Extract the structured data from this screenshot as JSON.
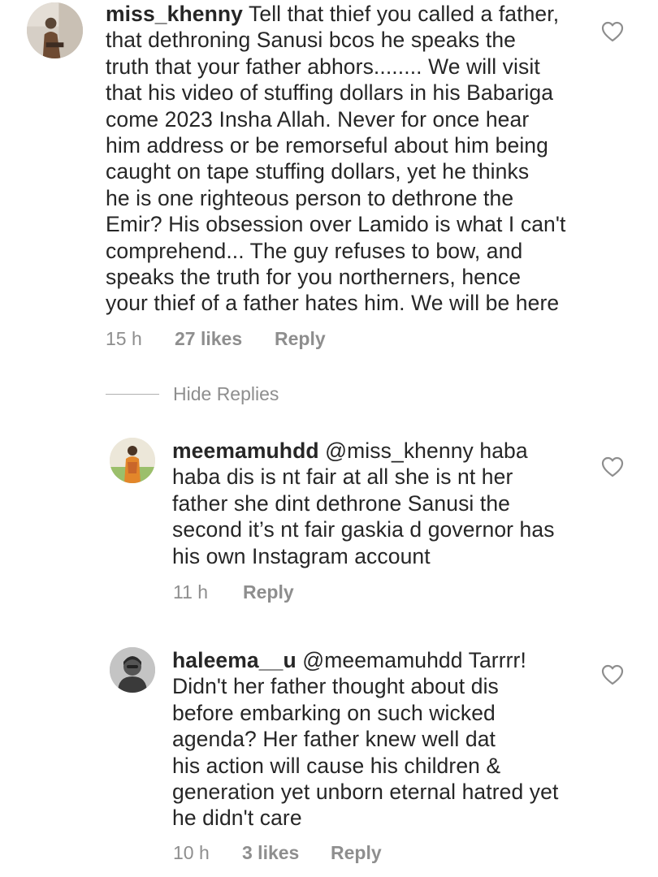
{
  "comments": [
    {
      "username": "miss_khenny",
      "mention": "",
      "lines": [
        "Tell that thief you called a father,",
        "that dethroning Sanusi bcos he speaks the",
        "truth that your father abhors........ We will visit",
        "that his video of stuffing dollars in his Babariga",
        "come 2023 Insha Allah. Never for once hear",
        "him address or be remorseful about him being",
        "caught on tape stuffing dollars,  yet he thinks",
        "he is one righteous person to dethrone the",
        "Emir? His obsession over Lamido is what I can't",
        "comprehend... The guy refuses to bow, and",
        "speaks the truth for you northerners,  hence",
        "your thief of a father hates him.  We will be here"
      ],
      "time": "15 h",
      "likes": "27 likes",
      "reply": "Reply",
      "avatar_icon": "user-avatar-photo",
      "heart_icon": "heart-outline-icon"
    },
    {
      "username": "meemamuhdd",
      "mention": "@miss_khenny",
      "lines": [
        "haba",
        "haba dis is nt fair at all she is nt her",
        "father she dint dethrone Sanusi the",
        "second it’s nt fair gaskia d governor has",
        "his own Instagram account"
      ],
      "time": "11 h",
      "likes": "",
      "reply": "Reply",
      "avatar_icon": "user-avatar-photo",
      "heart_icon": "heart-outline-icon"
    },
    {
      "username": "haleema__u",
      "mention": "@meemamuhdd",
      "lines": [
        "Tarrrr!",
        "Didn't her father thought about dis",
        "before embarking on such wicked",
        "agenda? Her father knew well dat",
        "his action will cause his children &",
        "generation yet unborn eternal hatred yet",
        "he didn't care"
      ],
      "time": "10 h",
      "likes": "3 likes",
      "reply": "Reply",
      "avatar_icon": "user-avatar-photo",
      "heart_icon": "heart-outline-icon"
    }
  ],
  "hide_replies_label": "Hide Replies",
  "colors": {
    "text": "#262626",
    "meta": "#8e8e8e",
    "background": "#ffffff"
  }
}
